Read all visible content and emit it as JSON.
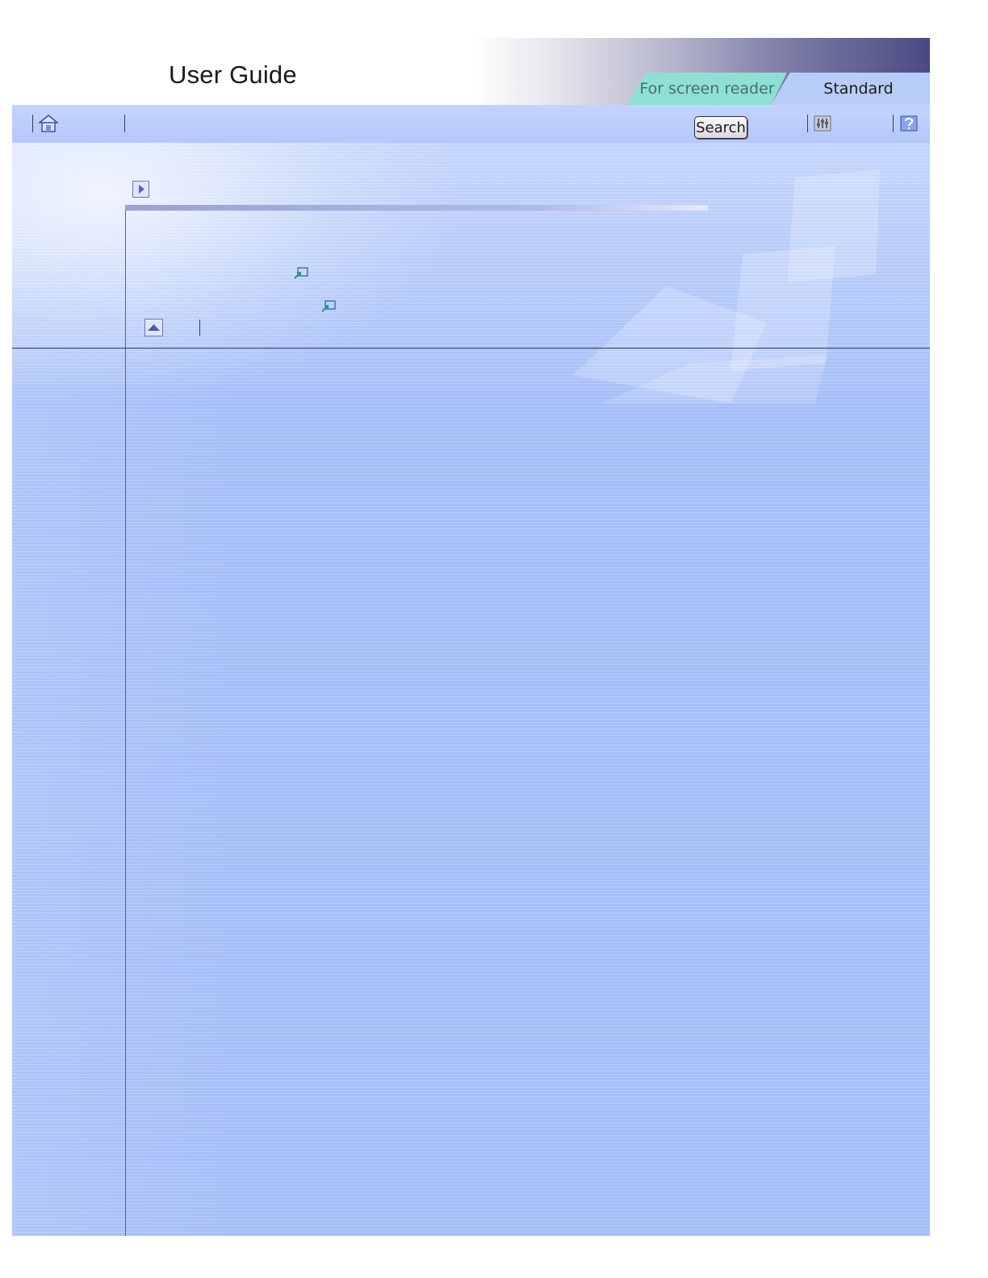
{
  "header": {
    "title": "User Guide",
    "tabs": [
      {
        "label": "For screen reader",
        "active": false
      },
      {
        "label": "Standard",
        "active": true
      }
    ]
  },
  "toolbar": {
    "search_label": "Search"
  },
  "colors": {
    "content_background": "#a4bef8",
    "active_tab": "#b8ccfa",
    "reader_tab": "#8fe0d4"
  }
}
